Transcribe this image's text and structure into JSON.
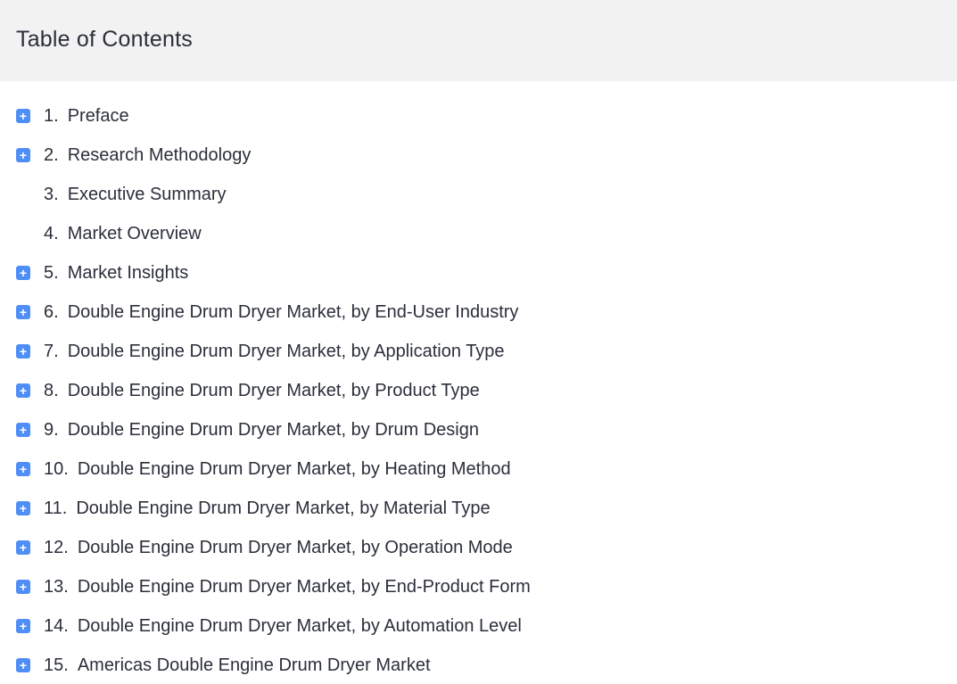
{
  "header": {
    "title": "Table of Contents"
  },
  "icons": {
    "expand": "plus-square-icon",
    "expand_glyph": "+",
    "accent_color": "#4f8ef7"
  },
  "toc": {
    "items": [
      {
        "num": "1.",
        "label": "Preface",
        "expandable": true
      },
      {
        "num": "2.",
        "label": "Research Methodology",
        "expandable": true
      },
      {
        "num": "3.",
        "label": "Executive Summary",
        "expandable": false
      },
      {
        "num": "4.",
        "label": "Market Overview",
        "expandable": false
      },
      {
        "num": "5.",
        "label": "Market Insights",
        "expandable": true
      },
      {
        "num": "6.",
        "label": "Double Engine Drum Dryer Market, by End-User Industry",
        "expandable": true
      },
      {
        "num": "7.",
        "label": "Double Engine Drum Dryer Market, by Application Type",
        "expandable": true
      },
      {
        "num": "8.",
        "label": "Double Engine Drum Dryer Market, by Product Type",
        "expandable": true
      },
      {
        "num": "9.",
        "label": "Double Engine Drum Dryer Market, by Drum Design",
        "expandable": true
      },
      {
        "num": "10.",
        "label": "Double Engine Drum Dryer Market, by Heating Method",
        "expandable": true
      },
      {
        "num": "11.",
        "label": "Double Engine Drum Dryer Market, by Material Type",
        "expandable": true
      },
      {
        "num": "12.",
        "label": "Double Engine Drum Dryer Market, by Operation Mode",
        "expandable": true
      },
      {
        "num": "13.",
        "label": "Double Engine Drum Dryer Market, by End-Product Form",
        "expandable": true
      },
      {
        "num": "14.",
        "label": "Double Engine Drum Dryer Market, by Automation Level",
        "expandable": true
      },
      {
        "num": "15.",
        "label": "Americas Double Engine Drum Dryer Market",
        "expandable": true
      }
    ]
  }
}
